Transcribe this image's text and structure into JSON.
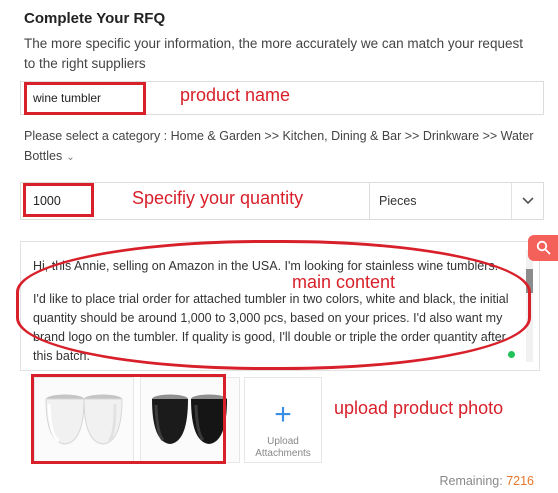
{
  "header": {
    "title": "Complete Your RFQ",
    "subtitle": "The more specific your information, the more accurately we can match your request to the right suppliers"
  },
  "product": {
    "name_value": "wine tumbler"
  },
  "category": {
    "text": "Please select a category : Home & Garden >> Kitchen, Dining & Bar >> Drinkware >> Water Bottles"
  },
  "quantity": {
    "value": "1000",
    "unit": "Pieces"
  },
  "message": {
    "paragraph1": "Hi, this Annie, selling on Amazon in the USA. I'm looking for stainless wine tumblers.",
    "paragraph2": "I'd like to place trial order for attached tumbler in two colors, white and black, the initial quantity should be around 1,000 to 3,000 pcs, based on your prices. I'd also want my brand logo on the tumbler. If quality is good, I'll double or triple the order quantity after this batch."
  },
  "attachments": {
    "upload_label": "Upload Attachments"
  },
  "remaining": {
    "label": "Remaining:",
    "count": "7216"
  },
  "annotations": {
    "product_name": "product name",
    "quantity": "Specifiy your quantity",
    "main_content": "main content",
    "upload_photo": "upload product photo"
  },
  "colors": {
    "annotation_red": "#d8202a",
    "accent_blue": "#3a8ee6",
    "remaining_orange": "#e8762c",
    "search_tab": "#f4605a",
    "status_green": "#20c25a"
  },
  "icons": [
    "chevron-down-icon",
    "search-icon",
    "plus-icon"
  ]
}
